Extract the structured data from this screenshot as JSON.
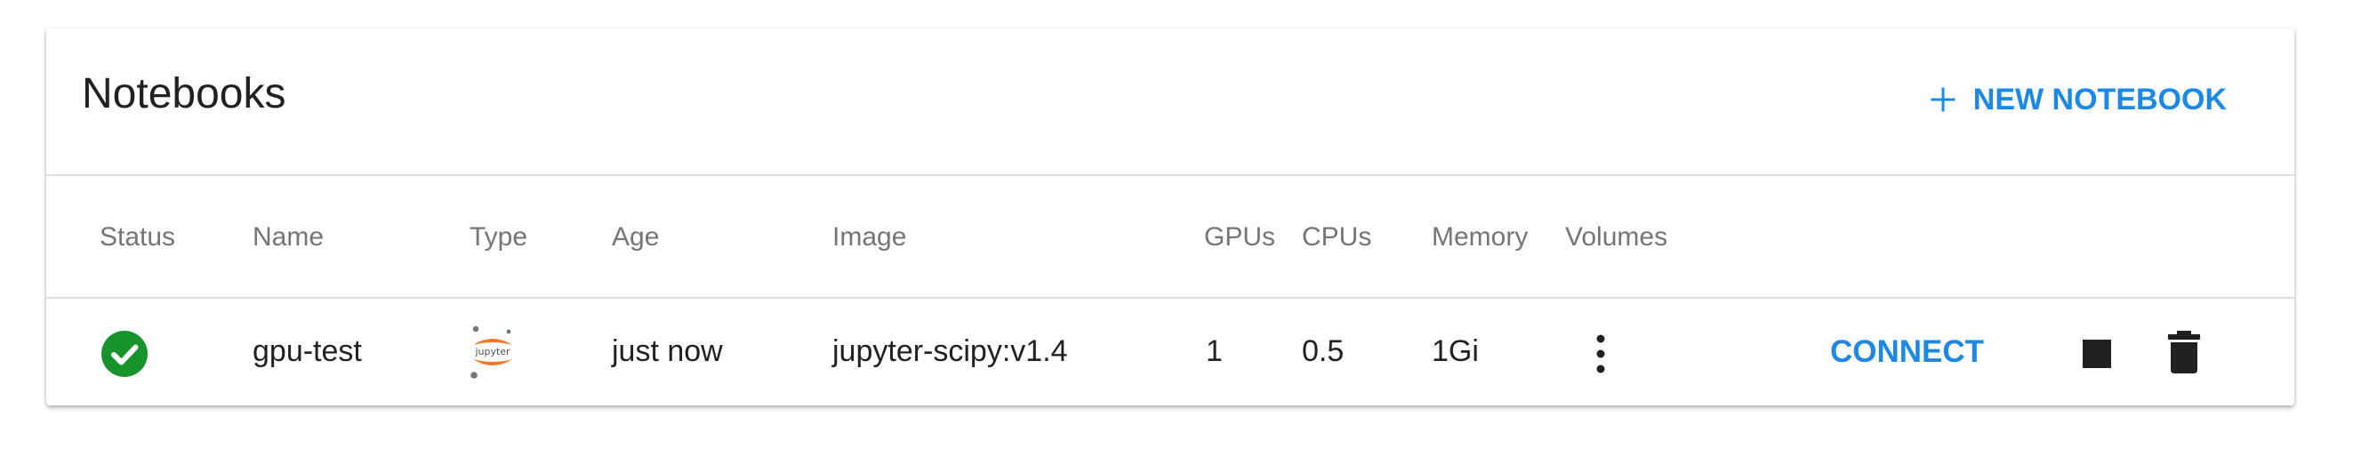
{
  "header": {
    "title": "Notebooks",
    "new_button_label": "NEW NOTEBOOK"
  },
  "table": {
    "columns": [
      "Status",
      "Name",
      "Type",
      "Age",
      "Image",
      "GPUs",
      "CPUs",
      "Memory",
      "Volumes"
    ],
    "rows": [
      {
        "status": "ready",
        "status_icon": "check-circle-icon",
        "name": "gpu-test",
        "type": "jupyter",
        "type_logo_text": "jupyter",
        "age": "just now",
        "image": "jupyter-scipy:v1.4",
        "gpus": "1",
        "cpus": "0.5",
        "memory": "1Gi",
        "volumes_icon": "more-vertical-icon",
        "connect_label": "CONNECT",
        "stop_icon": "stop-icon",
        "delete_icon": "trash-icon"
      }
    ]
  },
  "colors": {
    "accent": "#1e88e5",
    "status_ready": "#17932b",
    "jupyter_orange": "#f37726",
    "header_text": "#757575"
  }
}
